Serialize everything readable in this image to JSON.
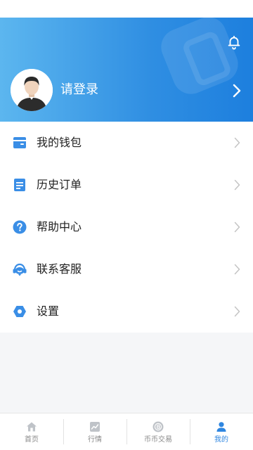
{
  "header": {
    "login_text": "请登录"
  },
  "menu": {
    "items": [
      {
        "label": "我的钱包",
        "icon": "wallet-icon"
      },
      {
        "label": "历史订单",
        "icon": "order-list-icon"
      },
      {
        "label": "帮助中心",
        "icon": "help-icon"
      },
      {
        "label": "联系客服",
        "icon": "headset-icon"
      },
      {
        "label": "设置",
        "icon": "settings-icon"
      }
    ]
  },
  "tabbar": {
    "items": [
      {
        "label": "首页",
        "icon": "home-icon",
        "active": false
      },
      {
        "label": "行情",
        "icon": "market-chart-icon",
        "active": false
      },
      {
        "label": "币币交易",
        "icon": "coin-icon",
        "active": false
      },
      {
        "label": "我的",
        "icon": "user-icon",
        "active": true
      }
    ]
  },
  "colors": {
    "accent": "#2f86e0",
    "header_start": "#5cb6ef",
    "header_end": "#1d7fde",
    "background": "#f5f6f8",
    "inactive_tab": "#8a8a8a"
  }
}
